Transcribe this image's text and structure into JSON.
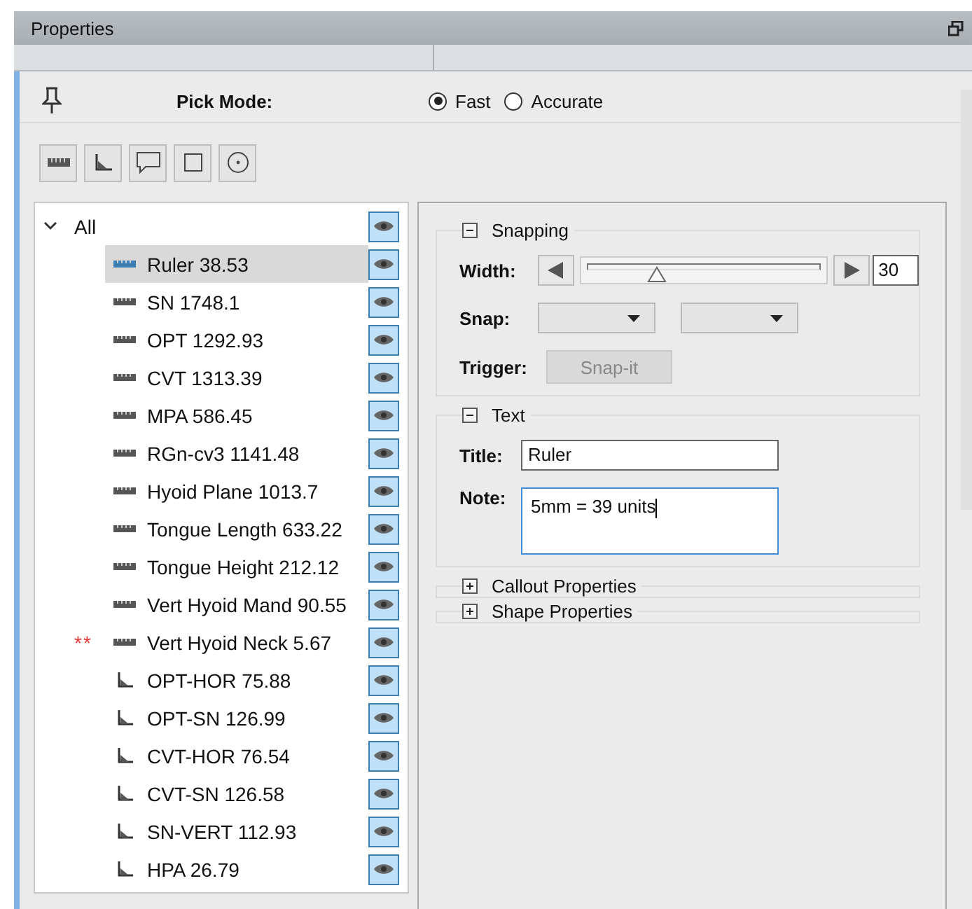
{
  "window": {
    "title": "Properties"
  },
  "pick_mode": {
    "label": "Pick Mode:",
    "options": [
      {
        "label": "Fast",
        "selected": true
      },
      {
        "label": "Accurate",
        "selected": false
      }
    ]
  },
  "tree": {
    "label": "All",
    "expanded": true,
    "visible": true,
    "children": [
      {
        "label": "Ruler 38.53",
        "kind": "ruler",
        "selected": true,
        "visible": true
      },
      {
        "label": "SN 1748.1",
        "kind": "ruler",
        "selected": false,
        "visible": true
      },
      {
        "label": "OPT 1292.93",
        "kind": "ruler",
        "selected": false,
        "visible": true
      },
      {
        "label": "CVT 1313.39",
        "kind": "ruler",
        "selected": false,
        "visible": true
      },
      {
        "label": "MPA 586.45",
        "kind": "ruler",
        "selected": false,
        "visible": true
      },
      {
        "label": "RGn-cv3 1141.48",
        "kind": "ruler",
        "selected": false,
        "visible": true
      },
      {
        "label": "Hyoid Plane 1013.7",
        "kind": "ruler",
        "selected": false,
        "visible": true
      },
      {
        "label": "Tongue Length 633.22",
        "kind": "ruler",
        "selected": false,
        "visible": true
      },
      {
        "label": "Tongue Height 212.12",
        "kind": "ruler",
        "selected": false,
        "visible": true
      },
      {
        "label": "Vert Hyoid Mand 90.55",
        "kind": "ruler",
        "selected": false,
        "visible": true
      },
      {
        "label": "Vert Hyoid Neck 5.67",
        "kind": "ruler",
        "selected": false,
        "visible": true,
        "marker": "**"
      },
      {
        "label": "OPT-HOR 75.88",
        "kind": "angle",
        "selected": false,
        "visible": true
      },
      {
        "label": "OPT-SN 126.99",
        "kind": "angle",
        "selected": false,
        "visible": true
      },
      {
        "label": "CVT-HOR 76.54",
        "kind": "angle",
        "selected": false,
        "visible": true
      },
      {
        "label": "CVT-SN 126.58",
        "kind": "angle",
        "selected": false,
        "visible": true
      },
      {
        "label": "SN-VERT 112.93",
        "kind": "angle",
        "selected": false,
        "visible": true
      },
      {
        "label": "HPA 26.79",
        "kind": "angle",
        "selected": false,
        "visible": true
      }
    ]
  },
  "sections": [
    {
      "kind": "snapping",
      "title": "Snapping",
      "expanded": true,
      "width_label": "Width:",
      "level": 0.31,
      "width_value": "30",
      "snap_label": "Snap:",
      "trigger_label": "Trigger:",
      "trigger_button": "Snap-it",
      "trigger_disabled": true
    },
    {
      "kind": "text",
      "title": "Text",
      "expanded": true,
      "title_label": "Title:",
      "title_value": "Ruler",
      "note_label": "Note:",
      "note_value": "5mm = 39 units"
    },
    {
      "kind": "collapsed",
      "title": "Callout Properties",
      "expanded": false
    },
    {
      "kind": "collapsed",
      "title": "Shape Properties",
      "expanded": false
    }
  ]
}
